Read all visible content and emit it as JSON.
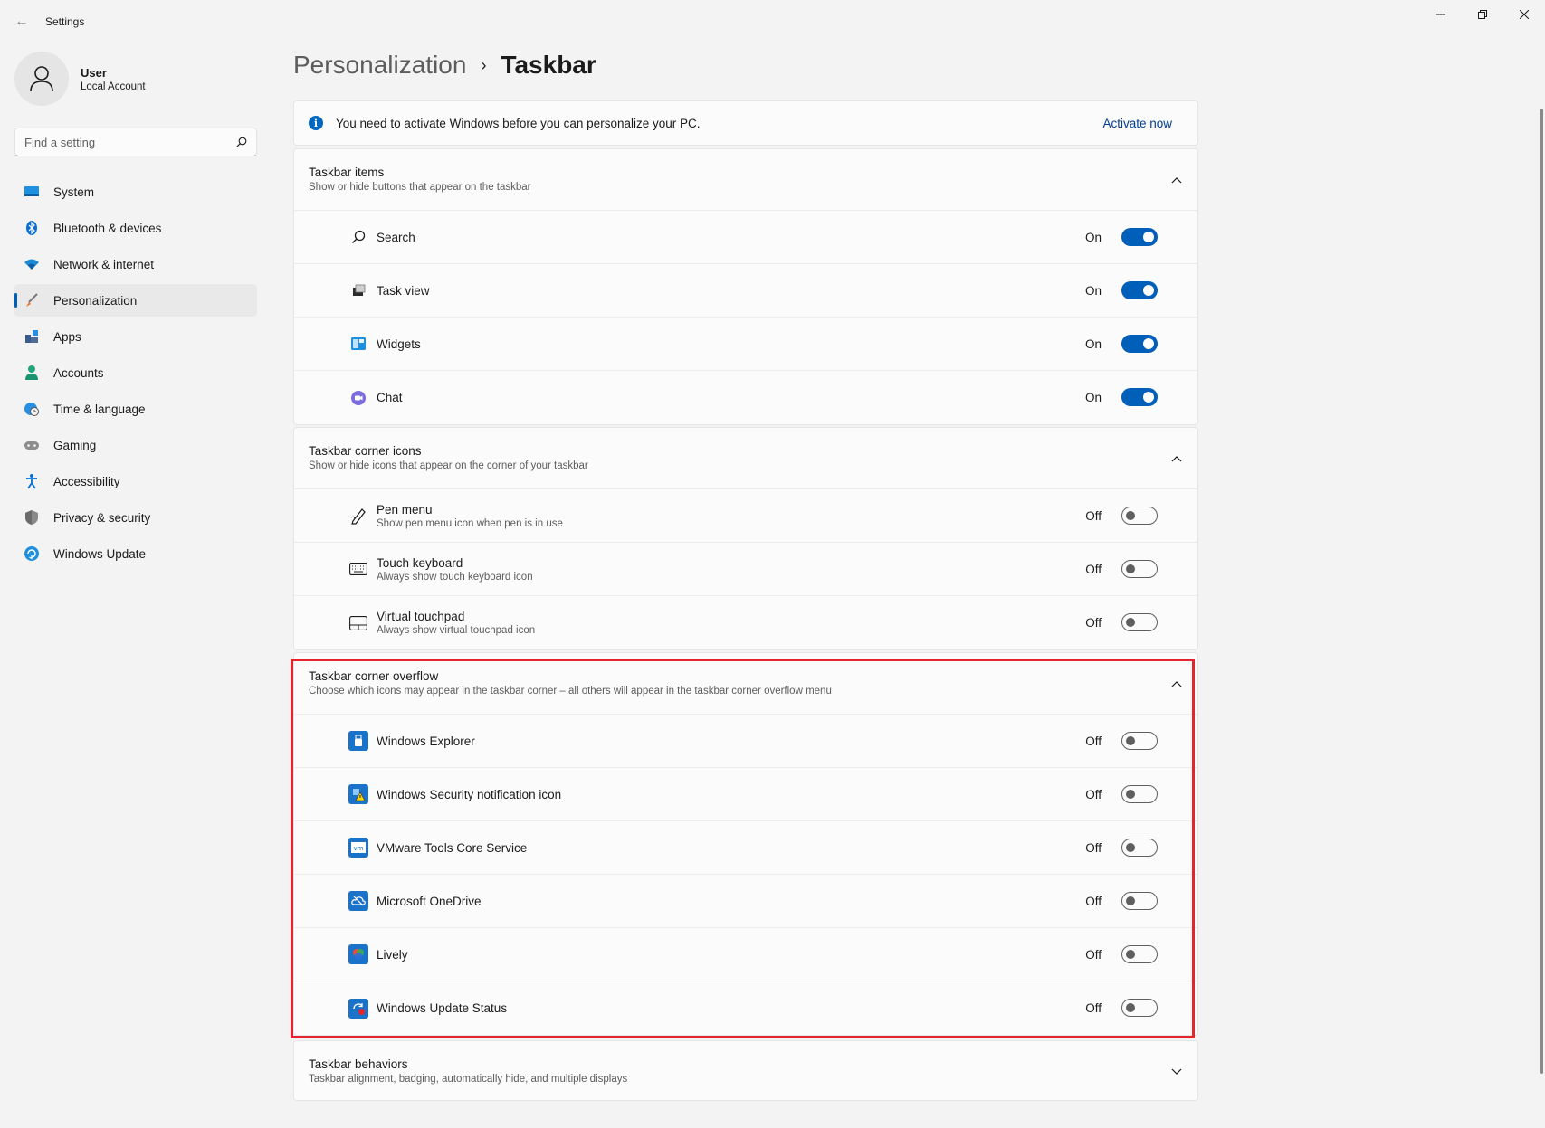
{
  "window": {
    "title": "Settings"
  },
  "user": {
    "name": "User",
    "account": "Local Account"
  },
  "search": {
    "placeholder": "Find a setting"
  },
  "nav": [
    {
      "label": "System",
      "icon": "monitor-icon"
    },
    {
      "label": "Bluetooth & devices",
      "icon": "bluetooth-icon"
    },
    {
      "label": "Network & internet",
      "icon": "wifi-icon"
    },
    {
      "label": "Personalization",
      "icon": "brush-icon",
      "active": true
    },
    {
      "label": "Apps",
      "icon": "apps-icon"
    },
    {
      "label": "Accounts",
      "icon": "person-icon"
    },
    {
      "label": "Time & language",
      "icon": "globe-clock-icon"
    },
    {
      "label": "Gaming",
      "icon": "gamepad-icon"
    },
    {
      "label": "Accessibility",
      "icon": "accessibility-icon"
    },
    {
      "label": "Privacy & security",
      "icon": "shield-icon"
    },
    {
      "label": "Windows Update",
      "icon": "update-icon"
    }
  ],
  "breadcrumb": {
    "parent": "Personalization",
    "current": "Taskbar"
  },
  "banner": {
    "text": "You need to activate Windows before you can personalize your PC.",
    "link": "Activate now"
  },
  "sections": {
    "items": {
      "title": "Taskbar items",
      "subtitle": "Show or hide buttons that appear on the taskbar",
      "rows": [
        {
          "label": "Search",
          "state": "On"
        },
        {
          "label": "Task view",
          "state": "On"
        },
        {
          "label": "Widgets",
          "state": "On"
        },
        {
          "label": "Chat",
          "state": "On"
        }
      ]
    },
    "corner_icons": {
      "title": "Taskbar corner icons",
      "subtitle": "Show or hide icons that appear on the corner of your taskbar",
      "rows": [
        {
          "label": "Pen menu",
          "sub": "Show pen menu icon when pen is in use",
          "state": "Off"
        },
        {
          "label": "Touch keyboard",
          "sub": "Always show touch keyboard icon",
          "state": "Off"
        },
        {
          "label": "Virtual touchpad",
          "sub": "Always show virtual touchpad icon",
          "state": "Off"
        }
      ]
    },
    "overflow": {
      "title": "Taskbar corner overflow",
      "subtitle": "Choose which icons may appear in the taskbar corner – all others will appear in the taskbar corner overflow menu",
      "rows": [
        {
          "label": "Windows Explorer",
          "state": "Off"
        },
        {
          "label": "Windows Security notification icon",
          "state": "Off"
        },
        {
          "label": "VMware Tools Core Service",
          "state": "Off"
        },
        {
          "label": "Microsoft OneDrive",
          "state": "Off"
        },
        {
          "label": "Lively",
          "state": "Off"
        },
        {
          "label": "Windows Update Status",
          "state": "Off"
        }
      ]
    },
    "behaviors": {
      "title": "Taskbar behaviors",
      "subtitle": "Taskbar alignment, badging, automatically hide, and multiple displays"
    }
  },
  "colors": {
    "accent": "#005fb8",
    "highlight": "#e3262d",
    "background": "#f3f3f3",
    "card": "#fbfbfb"
  }
}
